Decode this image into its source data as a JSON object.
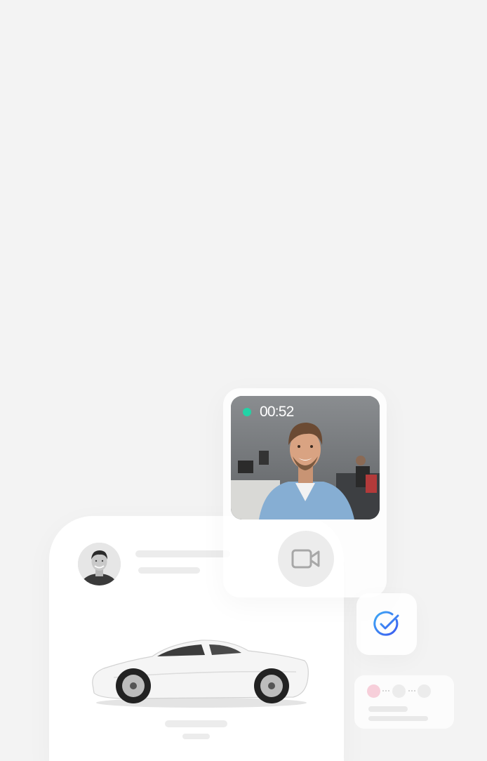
{
  "video_call": {
    "status": "live",
    "timer": "00:52",
    "live_color": "#22d3a6",
    "button_icon": "video-camera-icon"
  },
  "listing": {
    "avatar_icon": "user-avatar",
    "car_image": "white-sports-car"
  },
  "confirmation": {
    "icon": "check-circle-icon",
    "accent_color": "#3b6ff5"
  },
  "progress": {
    "steps_completed": 1,
    "steps_total": 3,
    "active_color": "#f7cfda"
  }
}
